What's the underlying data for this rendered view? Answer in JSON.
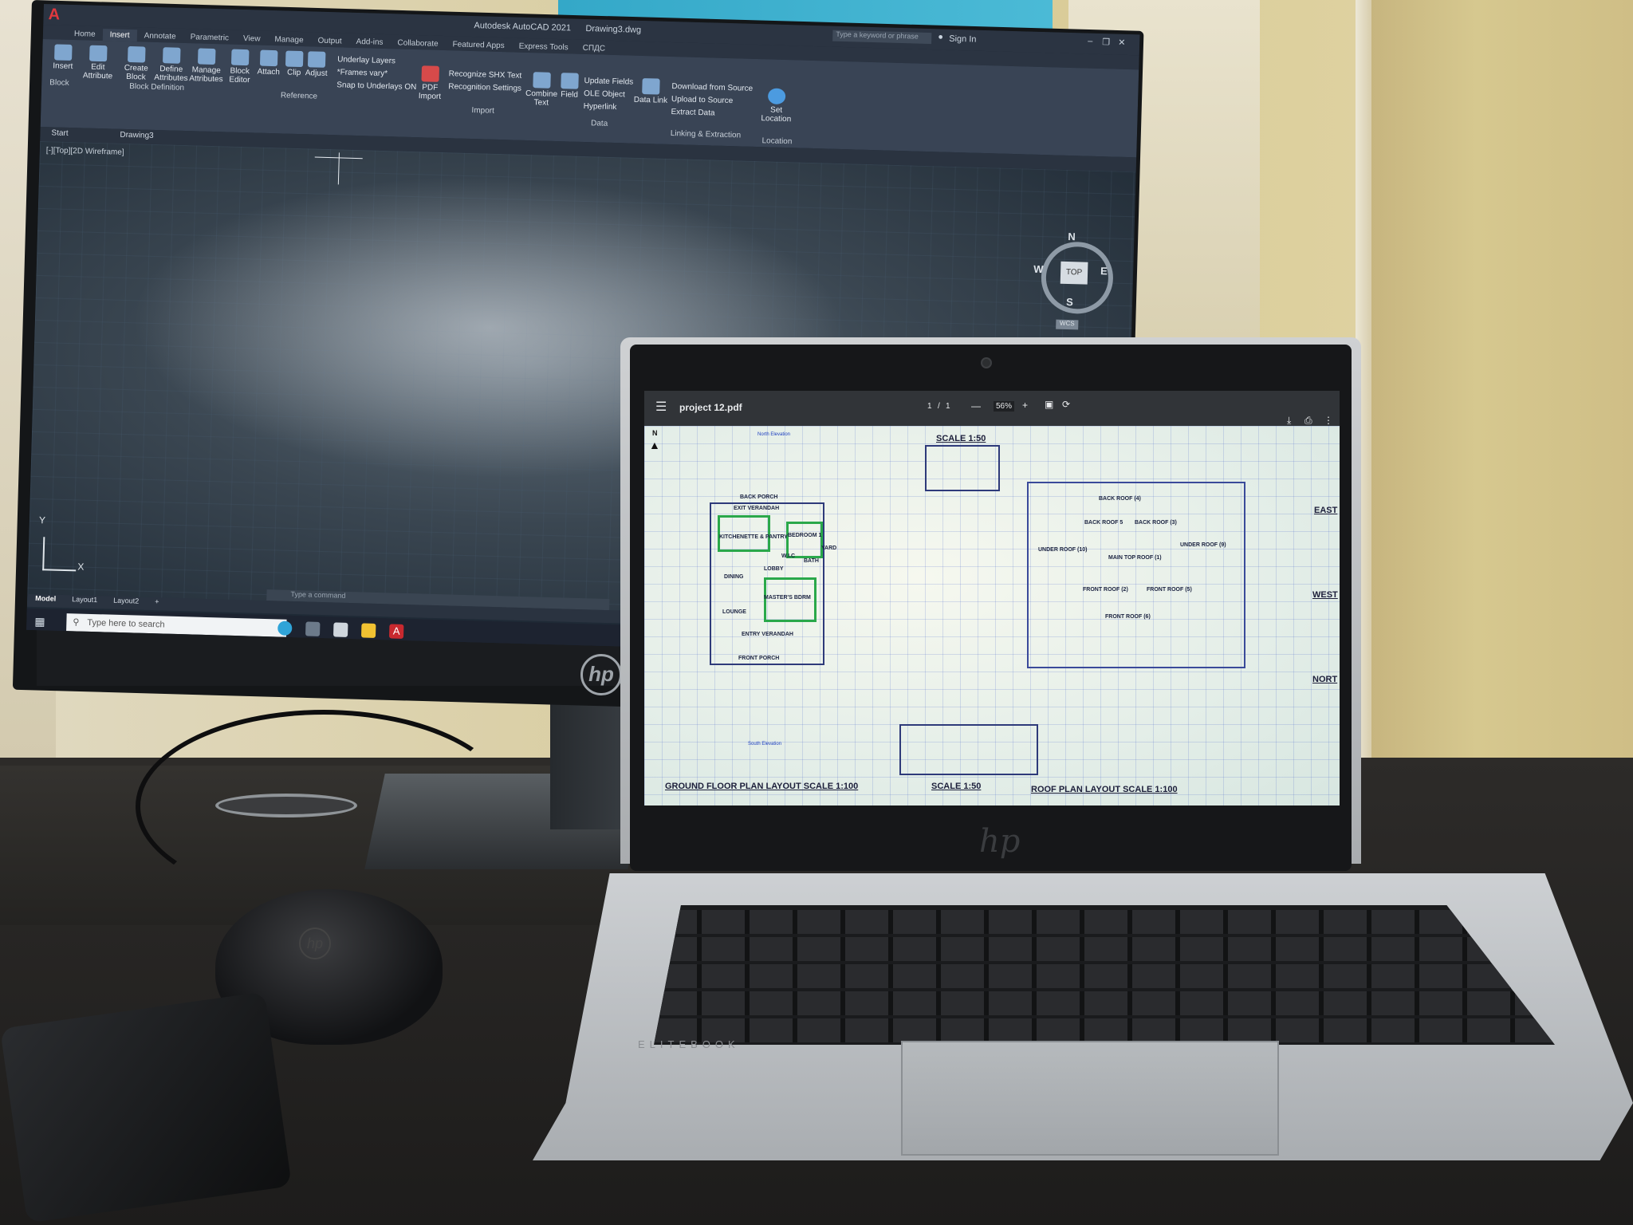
{
  "autocad": {
    "app_title": "Autodesk AutoCAD 2021",
    "file_title": "Drawing3.dwg",
    "search_placeholder": "Type a keyword or phrase",
    "sign_in": "Sign In",
    "tabs": [
      "Home",
      "Insert",
      "Annotate",
      "Parametric",
      "View",
      "Manage",
      "Output",
      "Add-ins",
      "Collaborate",
      "Featured Apps",
      "Express Tools",
      "СПДС"
    ],
    "ribbon": {
      "insert": "Insert",
      "edit_attribute": "Edit Attribute",
      "create_block": "Create Block",
      "define_attributes": "Define Attributes",
      "manage_attributes": "Manage Attributes",
      "block_editor": "Block Editor",
      "attach": "Attach",
      "clip": "Clip",
      "adjust": "Adjust",
      "underlay_layers": "Underlay Layers",
      "frames_vary": "*Frames vary*",
      "snap_to_underlays": "Snap to Underlays ON",
      "pdf_import": "PDF Import",
      "recognize_shx": "Recognize SHX Text",
      "recognition_settings": "Recognition Settings",
      "combine_text": "Combine Text",
      "field": "Field",
      "update_fields": "Update Fields",
      "ole_object": "OLE Object",
      "hyperlink": "Hyperlink",
      "data_link": "Data Link",
      "download_from_source": "Download from Source",
      "upload_to_source": "Upload to Source",
      "extract_data": "Extract Data",
      "set_location": "Set Location",
      "group_block": "Block",
      "group_block_definition": "Block Definition",
      "group_reference": "Reference",
      "group_import": "Import",
      "group_data": "Data",
      "group_linking": "Linking & Extraction",
      "group_location": "Location"
    },
    "doc_tabs": [
      "Start",
      "Drawing3"
    ],
    "viewport_label": "[-][Top][2D Wireframe]",
    "viewcube": {
      "top": "TOP",
      "n": "N",
      "s": "S",
      "e": "E",
      "w": "W",
      "wcs": "WCS"
    },
    "ucs": {
      "x": "X",
      "y": "Y"
    },
    "command_placeholder": "Type a command",
    "layout_tabs": [
      "Model",
      "Layout1",
      "Layout2"
    ],
    "add_tab": "+"
  },
  "taskbar": {
    "search_text": "Type here to search"
  },
  "pdf": {
    "filename": "project 12.pdf",
    "page_current": "1",
    "page_sep": "/",
    "page_total": "1",
    "zoom": "56%",
    "minus": "—",
    "plus": "+",
    "north": "N",
    "north_elevation": "North Elevation",
    "south_elevation": "South Elevation",
    "scale_top": "SCALE 1:50",
    "scale_bottom": "SCALE 1:50",
    "ground_floor_title": "GROUND FLOOR PLAN LAYOUT SCALE 1:100",
    "roof_plan_title": "ROOF PLAN LAYOUT SCALE 1:100",
    "east": "EAST",
    "west": "WEST",
    "north_label": "NORT",
    "rooms": [
      "BACK PORCH",
      "EXIT VERANDAH",
      "BEDROOM 1",
      "KITCHENETTE & PANTRY",
      "LOBBY",
      "W.I.C",
      "BATH",
      "DINING",
      "MASTER'S BDRM",
      "LOUNGE",
      "ENTRY VERANDAH",
      "FRONT PORCH",
      "YARD"
    ],
    "roofs": [
      "BACK ROOF (4)",
      "BACK ROOF 5",
      "BACK ROOF (3)",
      "UNDER ROOF (10)",
      "MAIN TOP ROOF (1)",
      "UNDER ROOF (9)",
      "FRONT ROOF (2)",
      "FRONT ROOF (5)",
      "FRONT ROOF (6)"
    ]
  },
  "monitor_brand": "hp",
  "laptop_brand": "hp",
  "laptop_model": "ELITEBOOK"
}
